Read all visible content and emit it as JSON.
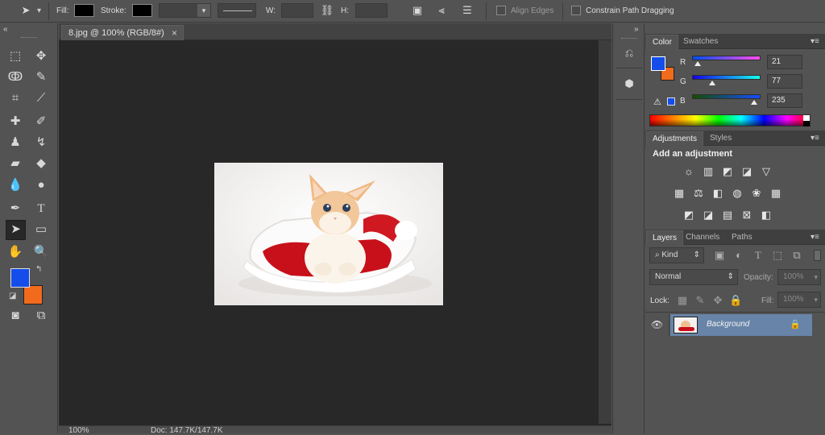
{
  "options_bar": {
    "fill_label": "Fill:",
    "stroke_label": "Stroke:",
    "w_label": "W:",
    "h_label": "H:",
    "align_edges_label": "Align Edges",
    "constrain_label": "Constrain Path Dragging"
  },
  "document": {
    "tab_title": "8.jpg @ 100% (RGB/8#)",
    "zoom": "100%",
    "doc_size": "Doc: 147.7K/147.7K"
  },
  "color_panel": {
    "tabs": [
      "Color",
      "Swatches"
    ],
    "r_label": "R",
    "g_label": "G",
    "b_label": "B",
    "r_value": "21",
    "g_value": "77",
    "b_value": "235",
    "foreground": "#154DEB",
    "background": "#F26B1D"
  },
  "adjustments_panel": {
    "tabs": [
      "Adjustments",
      "Styles"
    ],
    "heading": "Add an adjustment"
  },
  "layers_panel": {
    "tabs": [
      "Layers",
      "Channels",
      "Paths"
    ],
    "filter_label": "Kind",
    "blend_mode": "Normal",
    "opacity_label": "Opacity:",
    "opacity_value": "100%",
    "lock_label": "Lock:",
    "fill_label": "Fill:",
    "fill_value": "100%",
    "layers": [
      {
        "name": "Background"
      }
    ]
  }
}
